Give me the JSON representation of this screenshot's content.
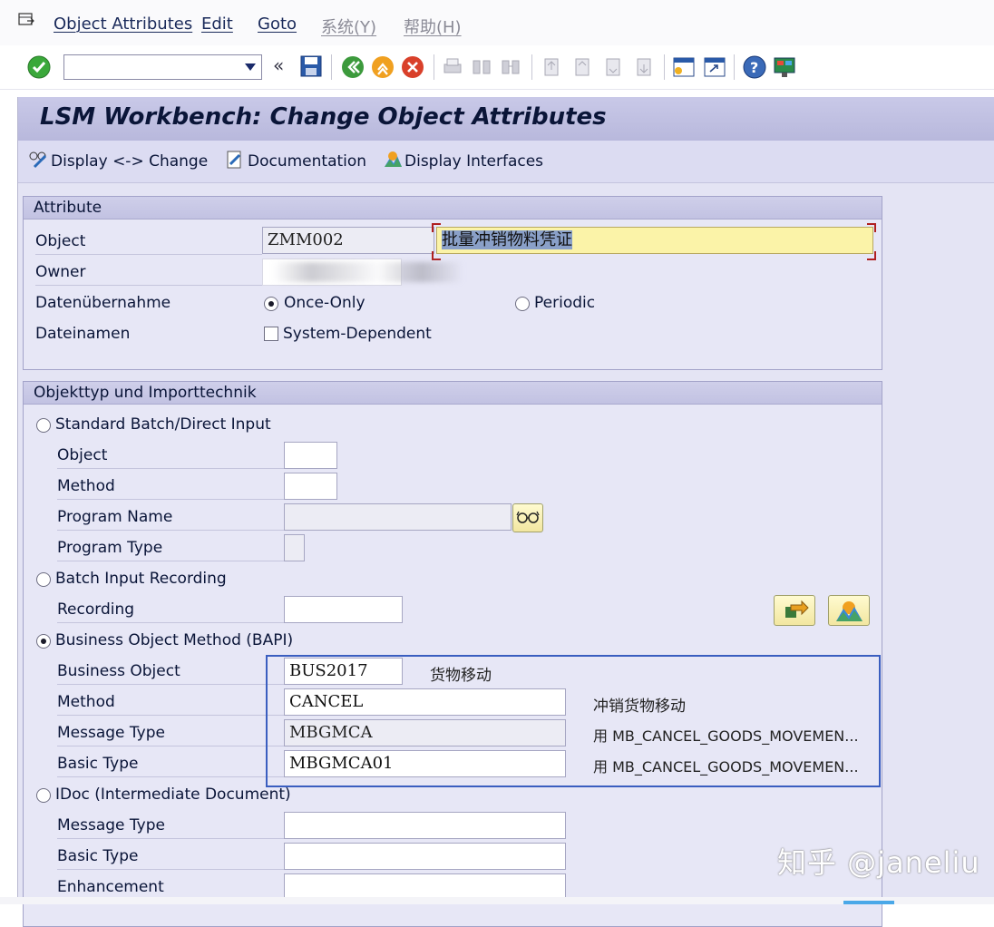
{
  "menubar": {
    "items": [
      {
        "label": "Object Attributes"
      },
      {
        "label": "Edit"
      },
      {
        "label": "Goto"
      },
      {
        "label": "系统(Y)"
      },
      {
        "label": "帮助(H)"
      }
    ]
  },
  "toolbar": {
    "command_field": {
      "value": "",
      "placeholder": ""
    }
  },
  "title": "LSM Workbench: Change Object Attributes",
  "appbar": {
    "display_change": "Display <-> Change",
    "documentation": "Documentation",
    "display_interfaces": "Display Interfaces"
  },
  "attribute": {
    "title": "Attribute",
    "object_label": "Object",
    "object_value": "ZMM002",
    "object_desc": "批量冲销物料凭证",
    "owner_label": "Owner",
    "daten_label": "Datenübernahme",
    "once_only": "Once-Only",
    "periodic": "Periodic",
    "dateinamen_label": "Dateinamen",
    "system_dependent": "System-Dependent"
  },
  "objtyp": {
    "title": "Objekttyp und Importtechnik",
    "standard_batch": "Standard Batch/Direct Input",
    "object_label": "Object",
    "method_label": "Method",
    "program_name_label": "Program Name",
    "program_type_label": "Program Type",
    "batch_input": "Batch Input Recording",
    "recording_label": "Recording",
    "bapi": "Business Object Method  (BAPI)",
    "business_object_label": "Business Object",
    "business_object_value": "BUS2017",
    "business_object_desc": "货物移动",
    "bapi_method_label": "Method",
    "bapi_method_value": "CANCEL",
    "bapi_method_desc": "冲销货物移动",
    "message_type_label": "Message Type",
    "message_type_value": "MBGMCA",
    "message_type_desc": "用 MB_CANCEL_GOODS_MOVEMEN...",
    "basic_type_label": "Basic Type",
    "basic_type_value": "MBGMCA01",
    "basic_type_desc": "用 MB_CANCEL_GOODS_MOVEMEN...",
    "idoc": "IDoc (Intermediate Document)",
    "idoc_message_type_label": "Message Type",
    "idoc_basic_type_label": "Basic Type",
    "enhancement_label": "Enhancement"
  },
  "watermark": "知乎 @janeliu"
}
